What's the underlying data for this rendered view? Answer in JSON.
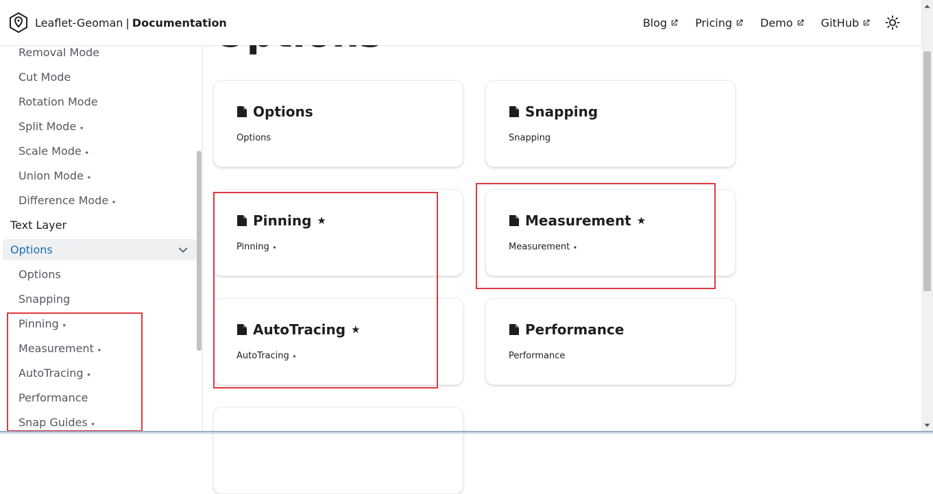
{
  "navbar": {
    "brand_name": "Leaflet-Geoman",
    "brand_separator": "|",
    "brand_section": "Documentation",
    "links": [
      {
        "label": "Blog"
      },
      {
        "label": "Pricing"
      },
      {
        "label": "Demo"
      },
      {
        "label": "GitHub"
      }
    ]
  },
  "sidebar": {
    "items_before": [
      {
        "label": "Removal Mode",
        "star": ""
      },
      {
        "label": "Cut Mode",
        "star": ""
      },
      {
        "label": "Rotation Mode",
        "star": ""
      },
      {
        "label": "Split Mode",
        "star": "⭑"
      },
      {
        "label": "Scale Mode",
        "star": "⭑"
      },
      {
        "label": "Union Mode",
        "star": "⭑"
      },
      {
        "label": "Difference Mode",
        "star": "⭑"
      }
    ],
    "text_layer": "Text Layer",
    "active_category": "Options",
    "items_after": [
      {
        "label": "Options",
        "star": ""
      },
      {
        "label": "Snapping",
        "star": ""
      },
      {
        "label": "Pinning",
        "star": "⭑"
      },
      {
        "label": "Measurement",
        "star": "⭑"
      },
      {
        "label": "AutoTracing",
        "star": "⭑"
      },
      {
        "label": "Performance",
        "star": ""
      },
      {
        "label": "Snap Guides",
        "star": "⭑"
      }
    ]
  },
  "main": {
    "title": "Options",
    "cards": [
      {
        "title": "Options",
        "title_star": "",
        "desc": "Options",
        "desc_star": ""
      },
      {
        "title": "Snapping",
        "title_star": "",
        "desc": "Snapping",
        "desc_star": ""
      },
      {
        "title": "Pinning",
        "title_star": "★",
        "desc": "Pinning",
        "desc_star": "⭑"
      },
      {
        "title": "Measurement",
        "title_star": "★",
        "desc": "Measurement",
        "desc_star": "⭑"
      },
      {
        "title": "AutoTracing",
        "title_star": "★",
        "desc": "AutoTracing",
        "desc_star": "⭑"
      },
      {
        "title": "Performance",
        "title_star": "",
        "desc": "Performance",
        "desc_star": ""
      }
    ]
  },
  "colors": {
    "accent": "#1a6db3",
    "highlight": "#e0393e",
    "text": "#1c1e21",
    "sidebar_text": "#525860"
  }
}
